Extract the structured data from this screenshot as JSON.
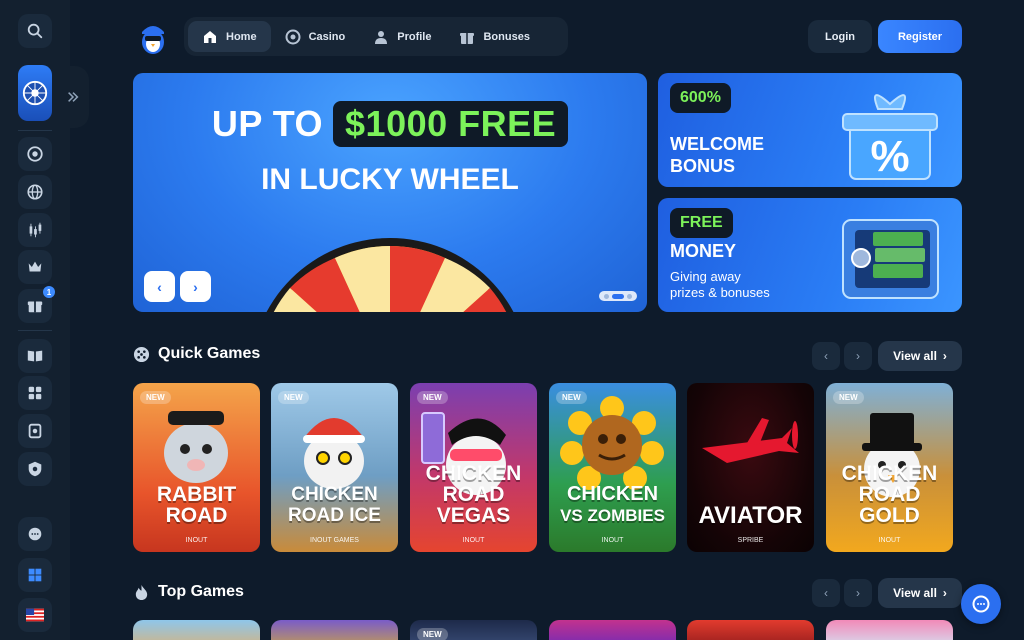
{
  "nav": {
    "items": [
      {
        "label": "Home",
        "icon": "home-icon",
        "active": true
      },
      {
        "label": "Casino",
        "icon": "chip-icon",
        "active": false
      },
      {
        "label": "Profile",
        "icon": "user-icon",
        "active": false
      },
      {
        "label": "Bonuses",
        "icon": "gift-icon",
        "active": false
      }
    ]
  },
  "auth": {
    "login": "Login",
    "register": "Register"
  },
  "sidebar": {
    "gift_badge": "1",
    "icons": [
      "search-icon",
      "lucky-wheel-promo",
      "chip-icon",
      "globe-icon",
      "candles-icon",
      "crown-icon",
      "gift-icon",
      "book-icon",
      "controller-icon",
      "coupon-icon",
      "shield-icon",
      "support-icon",
      "windows-icon",
      "us-flag-icon"
    ]
  },
  "hero": {
    "prefix": "UP TO",
    "highlight": "$1000 FREE",
    "line2": "IN LUCKY WHEEL",
    "prev": "‹",
    "next": "›"
  },
  "promos": [
    {
      "tag": "600%",
      "title_l1": "WELCOME",
      "title_l2": "BONUS"
    },
    {
      "tag": "FREE",
      "title_l1": "MONEY",
      "sub_l1": "Giving away",
      "sub_l2": "prizes & bonuses"
    }
  ],
  "quick_games": {
    "title": "Quick Games",
    "view_all": "View all",
    "games": [
      {
        "new": "NEW",
        "t1": "RABBIT",
        "t2": "ROAD",
        "provider": "INOUT"
      },
      {
        "new": "NEW",
        "t1": "CHICKEN",
        "t2": "ROAD ICE",
        "provider": "INOUT GAMES"
      },
      {
        "new": "NEW",
        "t1": "CHICKEN",
        "t2": "ROAD VEGAS",
        "provider": "INOUT"
      },
      {
        "new": "NEW",
        "t1": "CHICKEN",
        "t2": "VS ZOMBIES",
        "provider": "INOUT"
      },
      {
        "new": "",
        "t1": "AVIATOR",
        "t2": "",
        "provider": "SPRIBE"
      },
      {
        "new": "NEW",
        "t1": "CHICKEN",
        "t2": "ROAD GOLD",
        "provider": "INOUT"
      }
    ]
  },
  "top_games": {
    "title": "Top Games",
    "view_all": "View all",
    "new_badge": "NEW"
  },
  "colors": {
    "accent": "#2b6ff0",
    "highlight_green": "#7cf25a",
    "bg": "#0e1b2b"
  }
}
